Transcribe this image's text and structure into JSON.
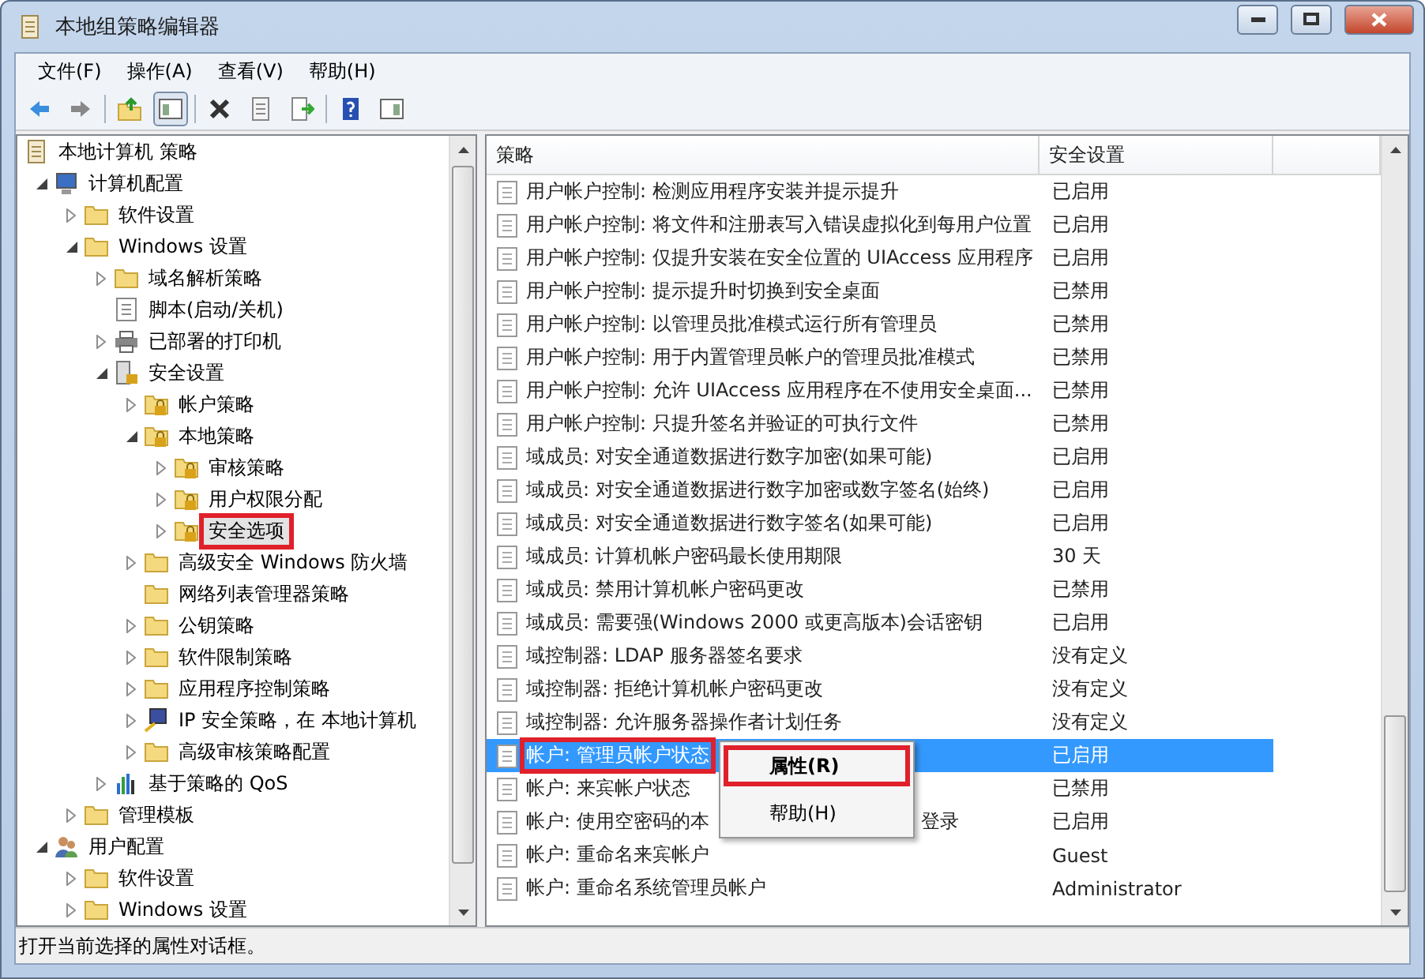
{
  "window": {
    "title": "本地组策略编辑器"
  },
  "menu": [
    "文件(F)",
    "操作(A)",
    "查看(V)",
    "帮助(H)"
  ],
  "toolbar": [
    {
      "kind": "back"
    },
    {
      "kind": "forward"
    },
    {
      "kind": "sep"
    },
    {
      "kind": "up"
    },
    {
      "kind": "tree",
      "pressed": true
    },
    {
      "kind": "sep"
    },
    {
      "kind": "delete"
    },
    {
      "kind": "properties"
    },
    {
      "kind": "export"
    },
    {
      "kind": "sep"
    },
    {
      "kind": "help"
    },
    {
      "kind": "pane"
    }
  ],
  "tree": [
    {
      "label": "本地计算机 策略",
      "kind": "policy",
      "selected": false,
      "highlighted": false,
      "children": [
        {
          "label": "计算机配置",
          "kind": "computer",
          "expanded": true,
          "selected": false,
          "highlighted": false,
          "children": [
            {
              "label": "软件设置",
              "kind": "folder",
              "expanded": false,
              "selected": false,
              "highlighted": false
            },
            {
              "label": "Windows 设置",
              "kind": "folder",
              "expanded": true,
              "selected": false,
              "highlighted": false,
              "children": [
                {
                  "label": "域名解析策略",
                  "kind": "folder",
                  "expanded": false,
                  "selected": false,
                  "highlighted": false
                },
                {
                  "label": "脚本(启动/关机)",
                  "kind": "script",
                  "selected": false,
                  "highlighted": false
                },
                {
                  "label": "已部署的打印机",
                  "kind": "printer",
                  "expanded": false,
                  "selected": false,
                  "highlighted": false
                },
                {
                  "label": "安全设置",
                  "kind": "security",
                  "expanded": true,
                  "selected": false,
                  "highlighted": false,
                  "children": [
                    {
                      "label": "帐户策略",
                      "kind": "lock-folder",
                      "expanded": false,
                      "selected": false,
                      "highlighted": false
                    },
                    {
                      "label": "本地策略",
                      "kind": "lock-folder",
                      "expanded": true,
                      "selected": false,
                      "highlighted": false,
                      "children": [
                        {
                          "label": "审核策略",
                          "kind": "lock-folder",
                          "expanded": false,
                          "selected": false,
                          "highlighted": false
                        },
                        {
                          "label": "用户权限分配",
                          "kind": "lock-folder",
                          "expanded": false,
                          "selected": false,
                          "highlighted": false
                        },
                        {
                          "label": "安全选项",
                          "kind": "lock-folder",
                          "expanded": false,
                          "selected": true,
                          "highlighted": true
                        }
                      ]
                    },
                    {
                      "label": "高级安全 Windows 防火墙",
                      "kind": "folder",
                      "expanded": false,
                      "selected": false,
                      "highlighted": false
                    },
                    {
                      "label": "网络列表管理器策略",
                      "kind": "folder",
                      "selected": false,
                      "highlighted": false
                    },
                    {
                      "label": "公钥策略",
                      "kind": "folder",
                      "expanded": false,
                      "selected": false,
                      "highlighted": false
                    },
                    {
                      "label": "软件限制策略",
                      "kind": "folder",
                      "expanded": false,
                      "selected": false,
                      "highlighted": false
                    },
                    {
                      "label": "应用程序控制策略",
                      "kind": "folder",
                      "expanded": false,
                      "selected": false,
                      "highlighted": false
                    },
                    {
                      "label": "IP 安全策略，在 本地计算机",
                      "kind": "ip",
                      "expanded": false,
                      "selected": false,
                      "highlighted": false
                    },
                    {
                      "label": "高级审核策略配置",
                      "kind": "folder",
                      "expanded": false,
                      "selected": false,
                      "highlighted": false
                    }
                  ]
                },
                {
                  "label": "基于策略的 QoS",
                  "kind": "chart",
                  "expanded": false,
                  "selected": false,
                  "highlighted": false
                }
              ]
            },
            {
              "label": "管理模板",
              "kind": "folder",
              "expanded": false,
              "selected": false,
              "highlighted": false
            }
          ]
        },
        {
          "label": "用户配置",
          "kind": "users",
          "expanded": true,
          "selected": false,
          "highlighted": false,
          "children": [
            {
              "label": "软件设置",
              "kind": "folder",
              "expanded": false,
              "selected": false,
              "highlighted": false
            },
            {
              "label": "Windows 设置",
              "kind": "folder",
              "expanded": false,
              "selected": false,
              "highlighted": false
            }
          ]
        }
      ]
    }
  ],
  "table": {
    "columns": [
      "策略",
      "安全设置"
    ],
    "rows": [
      {
        "policy": [
          "用户帐户控制: 检测应用程序安装并提示提升"
        ],
        "setting": "已启用",
        "selected": false,
        "highlighted": false
      },
      {
        "policy": [
          "用户帐户控制: 将文件和注册表写入错误虚拟化到每用户位置"
        ],
        "setting": "已启用",
        "selected": false,
        "highlighted": false
      },
      {
        "policy": [
          "用户帐户控制: 仅提升安装在安全位置的 UIAccess 应用程序"
        ],
        "setting": "已启用",
        "selected": false,
        "highlighted": false
      },
      {
        "policy": [
          "用户帐户控制: 提示提升时切换到安全桌面"
        ],
        "setting": "已禁用",
        "selected": false,
        "highlighted": false
      },
      {
        "policy": [
          "用户帐户控制: 以管理员批准模式运行所有管理员"
        ],
        "setting": "已禁用",
        "selected": false,
        "highlighted": false
      },
      {
        "policy": [
          "用户帐户控制: 用于内置管理员帐户的管理员批准模式"
        ],
        "setting": "已禁用",
        "selected": false,
        "highlighted": false
      },
      {
        "policy": [
          "用户帐户控制: 允许 UIAccess 应用程序在不使用安全桌面..."
        ],
        "setting": "已禁用",
        "selected": false,
        "highlighted": false
      },
      {
        "policy": [
          "用户帐户控制: 只提升签名并验证的可执行文件"
        ],
        "setting": "已禁用",
        "selected": false,
        "highlighted": false
      },
      {
        "policy": [
          "域成员: 对安全通道数据进行数字加密(如果可能)"
        ],
        "setting": "已启用",
        "selected": false,
        "highlighted": false
      },
      {
        "policy": [
          "域成员: 对安全通道数据进行数字加密或数字签名(始终)"
        ],
        "setting": "已启用",
        "selected": false,
        "highlighted": false
      },
      {
        "policy": [
          "域成员: 对安全通道数据进行数字签名(如果可能)"
        ],
        "setting": "已启用",
        "selected": false,
        "highlighted": false
      },
      {
        "policy": [
          "域成员: 计算机帐户密码最长使用期限"
        ],
        "setting": "30 天",
        "selected": false,
        "highlighted": false
      },
      {
        "policy": [
          "域成员: 禁用计算机帐户密码更改"
        ],
        "setting": "已禁用",
        "selected": false,
        "highlighted": false
      },
      {
        "policy": [
          "域成员: 需要强(Windows 2000 或更高版本)会话密钥"
        ],
        "setting": "已启用",
        "selected": false,
        "highlighted": false
      },
      {
        "policy": [
          "域控制器: LDAP 服务器签名要求"
        ],
        "setting": "没有定义",
        "selected": false,
        "highlighted": false
      },
      {
        "policy": [
          "域控制器: 拒绝计算机帐户密码更改"
        ],
        "setting": "没有定义",
        "selected": false,
        "highlighted": false
      },
      {
        "policy": [
          "域控制器: 允许服务器操作者计划任务"
        ],
        "setting": "没有定义",
        "selected": false,
        "highlighted": false
      },
      {
        "policy": [
          "帐户: 管理员帐户状态"
        ],
        "setting": "已启用",
        "selected": true,
        "highlighted": true
      },
      {
        "policy": [
          "帐户: 来宾帐户状态"
        ],
        "setting": "已禁用",
        "selected": false,
        "highlighted": false
      },
      {
        "policy": [
          "帐户: 使用空密码的本",
          "登录"
        ],
        "setting": "已启用",
        "selected": false,
        "highlighted": false
      },
      {
        "policy": [
          "帐户: 重命名来宾帐户"
        ],
        "setting": "Guest",
        "selected": false,
        "highlighted": false
      },
      {
        "policy": [
          "帐户: 重命名系统管理员帐户"
        ],
        "setting": "Administrator",
        "selected": false,
        "highlighted": false
      }
    ]
  },
  "context_menu": [
    {
      "label": "属性(R)",
      "bold": true,
      "highlighted": true
    },
    {
      "label": "帮助(H)",
      "bold": false,
      "highlighted": false
    }
  ],
  "status_bar": "打开当前选择的属性对话框。"
}
